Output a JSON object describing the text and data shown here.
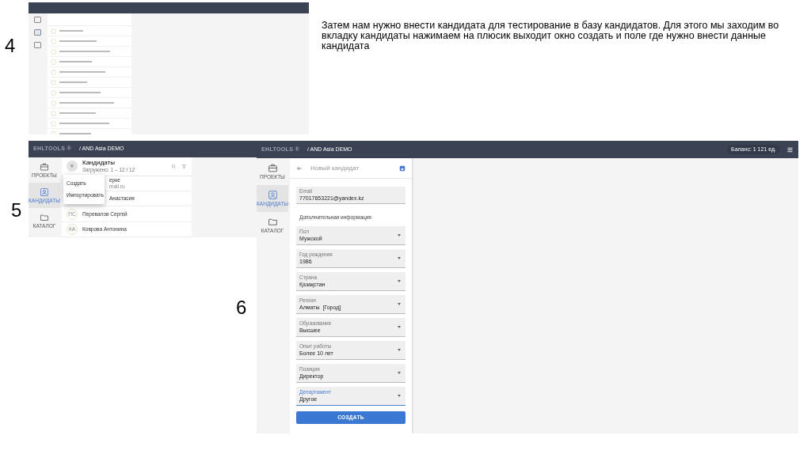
{
  "caption": "Затем нам нужно внести кандидата для тестирование в базу кандидатов. Для этого мы заходим во вкладку кандидаты нажимаем на плюсик выходит окно создать и поле где нужно внести данные кандидата",
  "step_4": {
    "number": "4"
  },
  "step_5": {
    "number": "5",
    "brand": "EHLTOOLS ®",
    "project": "/ AND Asia DEMO",
    "nav": [
      {
        "label": "ПРОЕКТЫ",
        "selected": false
      },
      {
        "label": "КАНДИДАТЫ",
        "selected": true
      },
      {
        "label": "КАТАЛОГ",
        "selected": false
      }
    ],
    "list": {
      "add": "+",
      "title": "Кандидаты",
      "loaded": "Загружено: 1 – 12 / 12",
      "rows": [
        {
          "covered": true,
          "name": "ерке",
          "email": "mail.ru"
        },
        {
          "covered": true,
          "name": "Анастасия"
        },
        {
          "covered": false,
          "initials": "ПС",
          "name": "Перевалов Сергей"
        },
        {
          "covered": false,
          "initials": "КА",
          "name": "Коврова Антонина"
        }
      ]
    },
    "menu": [
      "Создать",
      "Импортировать"
    ]
  },
  "step_6": {
    "number": "6",
    "brand": "EHLTOOLS ®",
    "project": "/ AND Asia DEMO",
    "balance": "Баланс: 1 121 ед.",
    "nav": [
      {
        "label": "ПРОЕКТЫ",
        "selected": false
      },
      {
        "label": "КАНДИДАТЫ",
        "selected": true
      },
      {
        "label": "КАТАЛОГ",
        "selected": false
      }
    ],
    "form": {
      "title": "Новый кандидат",
      "email": {
        "label": "Email",
        "value": "77017653221@yandex.kz"
      },
      "section": "Дополнительная информация",
      "selects": [
        {
          "label": "Пол",
          "value": "Мужской",
          "focused": false
        },
        {
          "label": "Год рождения",
          "value": "1986",
          "focused": false
        },
        {
          "label": "Страна",
          "value": "Қазақстан",
          "focused": false
        },
        {
          "label": "Регион",
          "value": "Алматы  [Город]",
          "focused": false
        },
        {
          "label": "Образование",
          "value": "Высшее",
          "focused": false
        },
        {
          "label": "Опыт работы",
          "value": "Более 10 лет",
          "focused": false
        },
        {
          "label": "Позиция",
          "value": "Директор",
          "focused": false
        },
        {
          "label": "Департамент",
          "value": "Другое",
          "focused": true
        }
      ],
      "submit": "СОЗДАТЬ"
    }
  }
}
